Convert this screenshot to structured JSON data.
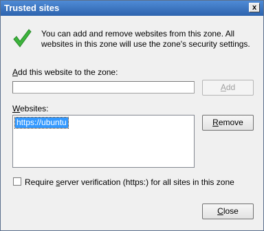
{
  "window": {
    "title": "Trusted sites",
    "close_glyph": "x"
  },
  "intro": {
    "text": "You can add and remove websites from this zone. All websites in this zone will use the zone's security settings."
  },
  "add_section": {
    "label_prefix": "",
    "label_access": "A",
    "label_rest": "dd this website to the zone:",
    "input_value": "",
    "add_label_access": "A",
    "add_label_rest": "dd"
  },
  "websites": {
    "label_access": "W",
    "label_rest": "ebsites:",
    "items": [
      "https://ubuntu"
    ],
    "remove_label_access": "R",
    "remove_label_rest": "emove"
  },
  "https_option": {
    "label_before": "Require ",
    "label_access": "s",
    "label_after": "erver verification (https:) for all sites in this zone",
    "checked": false
  },
  "footer": {
    "close_label_access": "C",
    "close_label_rest": "lose"
  },
  "colors": {
    "titlebar": "#3d79c3",
    "selection": "#3399ff",
    "check": "#3cb43c"
  }
}
